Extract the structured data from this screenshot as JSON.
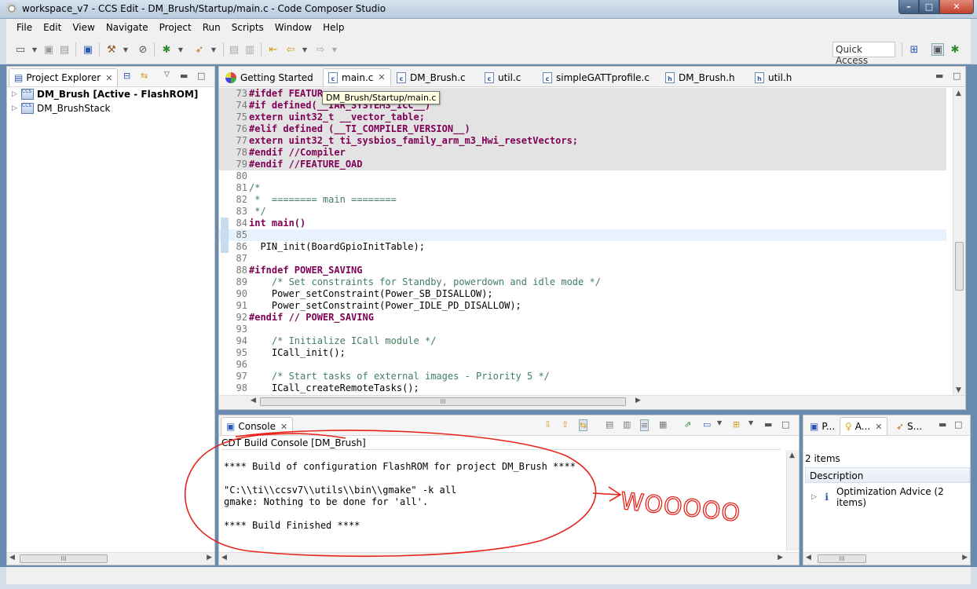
{
  "window": {
    "title": "workspace_v7 - CCS Edit - DM_Brush/Startup/main.c - Code Composer Studio",
    "minimize": "–",
    "maximize": "□",
    "close": "✕"
  },
  "menu": [
    "File",
    "Edit",
    "View",
    "Navigate",
    "Project",
    "Run",
    "Scripts",
    "Window",
    "Help"
  ],
  "toolbar": {
    "quick_access": "Quick Access"
  },
  "project_explorer": {
    "tab_label": "Project Explorer",
    "items": [
      {
        "label": "DM_Brush  [Active - FlashROM]",
        "bold": true
      },
      {
        "label": "DM_BrushStack",
        "bold": false
      }
    ]
  },
  "editor": {
    "tabs": [
      {
        "label": "Getting Started",
        "icon": "getting-started-icon"
      },
      {
        "label": "main.c",
        "icon": "c-file-icon",
        "active": true
      },
      {
        "label": "DM_Brush.c",
        "icon": "c-file-icon"
      },
      {
        "label": "util.c",
        "icon": "c-file-icon"
      },
      {
        "label": "simpleGATTprofile.c",
        "icon": "c-file-icon"
      },
      {
        "label": "DM_Brush.h",
        "icon": "h-file-icon"
      },
      {
        "label": "util.h",
        "icon": "h-file-icon"
      }
    ],
    "tooltip": "DM_Brush/Startup/main.c",
    "lines": [
      {
        "num": "73",
        "text": "#ifdef FEATUR",
        "shaded": true
      },
      {
        "num": "74",
        "text": "#if defined(__IAR_SYSTEMS_ICC__)",
        "shaded": true
      },
      {
        "num": "75",
        "text": "extern uint32_t __vector_table;",
        "shaded": true
      },
      {
        "num": "76",
        "text": "#elif defined (__TI_COMPILER_VERSION__)",
        "shaded": true
      },
      {
        "num": "77",
        "text": "extern uint32_t ti_sysbios_family_arm_m3_Hwi_resetVectors;",
        "shaded": true
      },
      {
        "num": "78",
        "text": "#endif //Compiler",
        "shaded": true
      },
      {
        "num": "79",
        "text": "#endif //FEATURE_OAD",
        "shaded": true
      },
      {
        "num": "80",
        "text": ""
      },
      {
        "num": "81",
        "text": "/*"
      },
      {
        "num": "82",
        "text": " *  ======== main ========"
      },
      {
        "num": "83",
        "text": " */"
      },
      {
        "num": "84",
        "text": "int main()"
      },
      {
        "num": "85",
        "text": "",
        "current": true
      },
      {
        "num": "86",
        "text": "  PIN_init(BoardGpioInitTable);"
      },
      {
        "num": "87",
        "text": ""
      },
      {
        "num": "88",
        "text": "#ifndef POWER_SAVING"
      },
      {
        "num": "89",
        "text": "    /* Set constraints for Standby, powerdown and idle mode */"
      },
      {
        "num": "90",
        "text": "    Power_setConstraint(Power_SB_DISALLOW);"
      },
      {
        "num": "91",
        "text": "    Power_setConstraint(Power_IDLE_PD_DISALLOW);"
      },
      {
        "num": "92",
        "text": "#endif // POWER_SAVING"
      },
      {
        "num": "93",
        "text": ""
      },
      {
        "num": "94",
        "text": "    /* Initialize ICall module */"
      },
      {
        "num": "95",
        "text": "    ICall_init();"
      },
      {
        "num": "96",
        "text": ""
      },
      {
        "num": "97",
        "text": "    /* Start tasks of external images - Priority 5 */"
      },
      {
        "num": "98",
        "text": "    ICall_createRemoteTasks();"
      }
    ]
  },
  "console": {
    "tab_label": "Console",
    "title": "CDT Build Console [DM_Brush]",
    "lines": [
      "**** Build of configuration FlashROM for project DM_Brush ****",
      "",
      "\"C:\\\\ti\\\\ccsv7\\\\utils\\\\bin\\\\gmake\" -k all",
      "gmake: Nothing to be done for 'all'.",
      "",
      "**** Build Finished ****"
    ]
  },
  "right_panel": {
    "tabs": [
      "P...",
      "A...",
      "S..."
    ],
    "items_count": "2 items",
    "column_header": "Description",
    "row_label": "Optimization Advice (2 items)"
  },
  "annotation": {
    "text": "WOOOOO",
    "color": "#e8231c"
  },
  "scroll_glyph": "III"
}
